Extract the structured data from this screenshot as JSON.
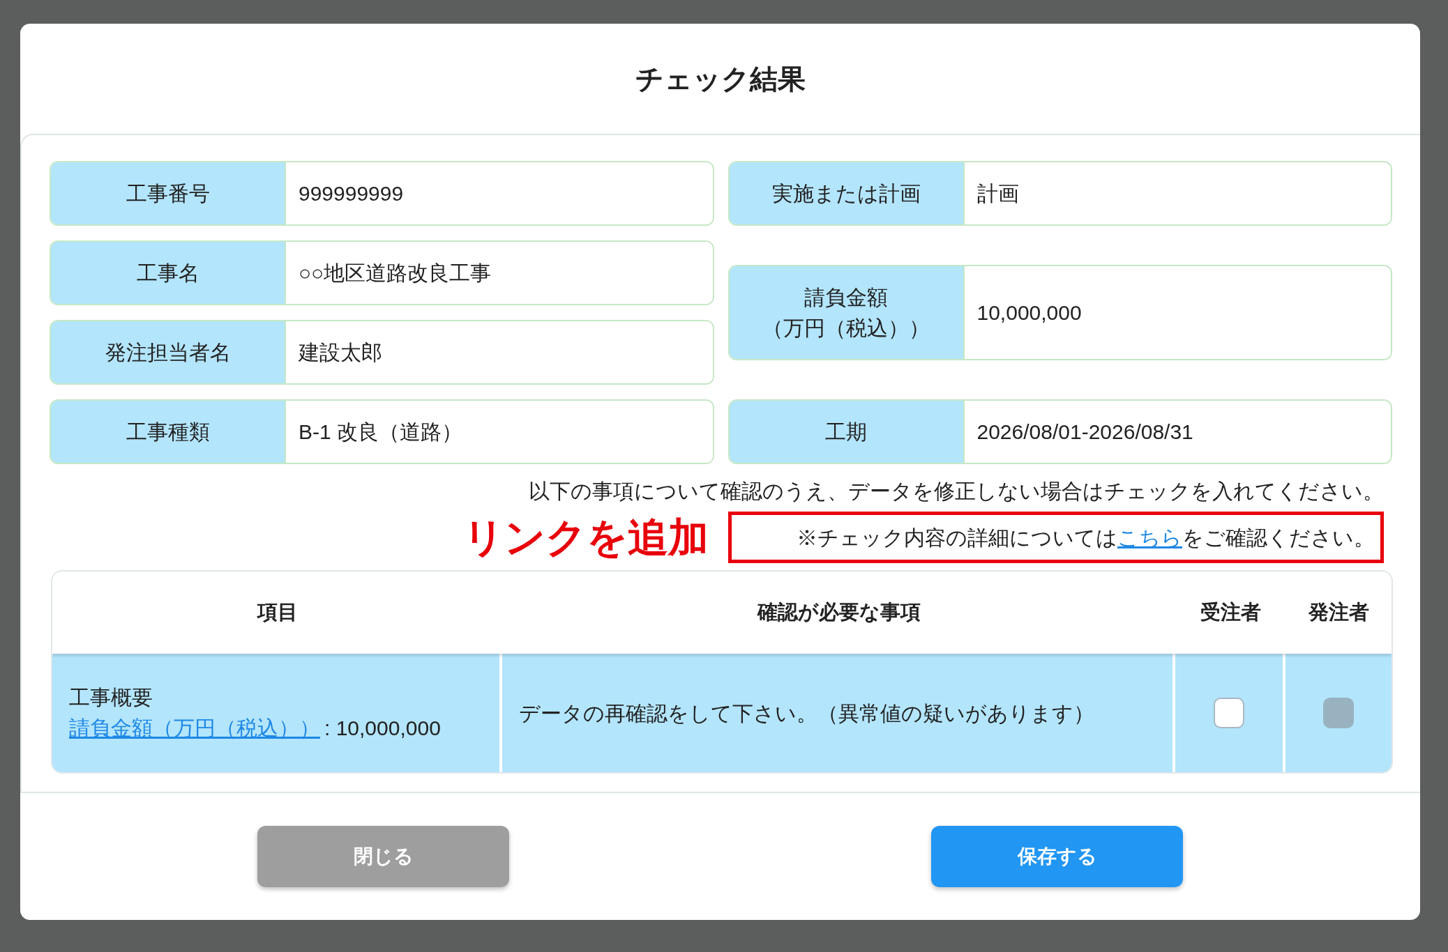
{
  "dialog": {
    "title": "チェック結果"
  },
  "left_fields": [
    {
      "label_lines": [
        "工事番号"
      ],
      "value": "999999999"
    },
    {
      "label_lines": [
        "工事名"
      ],
      "value": "○○地区道路改良工事"
    },
    {
      "label_lines": [
        "発注担当者名"
      ],
      "value": "建設太郎"
    },
    {
      "label_lines": [
        "工事種類"
      ],
      "value": "B-1 改良（道路）"
    }
  ],
  "right_fields": [
    {
      "label_lines": [
        "実施または計画"
      ],
      "value": "計画"
    },
    {
      "label_lines": [
        "請負金額",
        "（万円（税込））"
      ],
      "value": "10,000,000"
    },
    {
      "label_lines": [
        "工期"
      ],
      "value": "2026/08/01-2026/08/31"
    }
  ],
  "instruction": "以下の事項について確認のうえ、データを修正しない場合はチェックを入れてください。",
  "annotation": "リンクを追加",
  "detail_note": {
    "before": "※チェック内容の詳細については",
    "link": "こちら",
    "after": "をご確認ください。"
  },
  "table": {
    "columns": [
      "項目",
      "確認が必要な事項",
      "受注者",
      "発注者"
    ],
    "rows": [
      {
        "item_title": "工事概要",
        "item_link": "請負金額（万円（税込））",
        "item_value": ": 10,000,000",
        "message": "データの再確認をして下さい。（異常値の疑いがあります）",
        "contractor_check": {
          "checked": false,
          "disabled": false
        },
        "orderer_check": {
          "checked": false,
          "disabled": true
        }
      }
    ]
  },
  "buttons": [
    {
      "label": "閉じる",
      "kind": "secondary"
    },
    {
      "label": "保存する",
      "kind": "primary"
    }
  ]
}
